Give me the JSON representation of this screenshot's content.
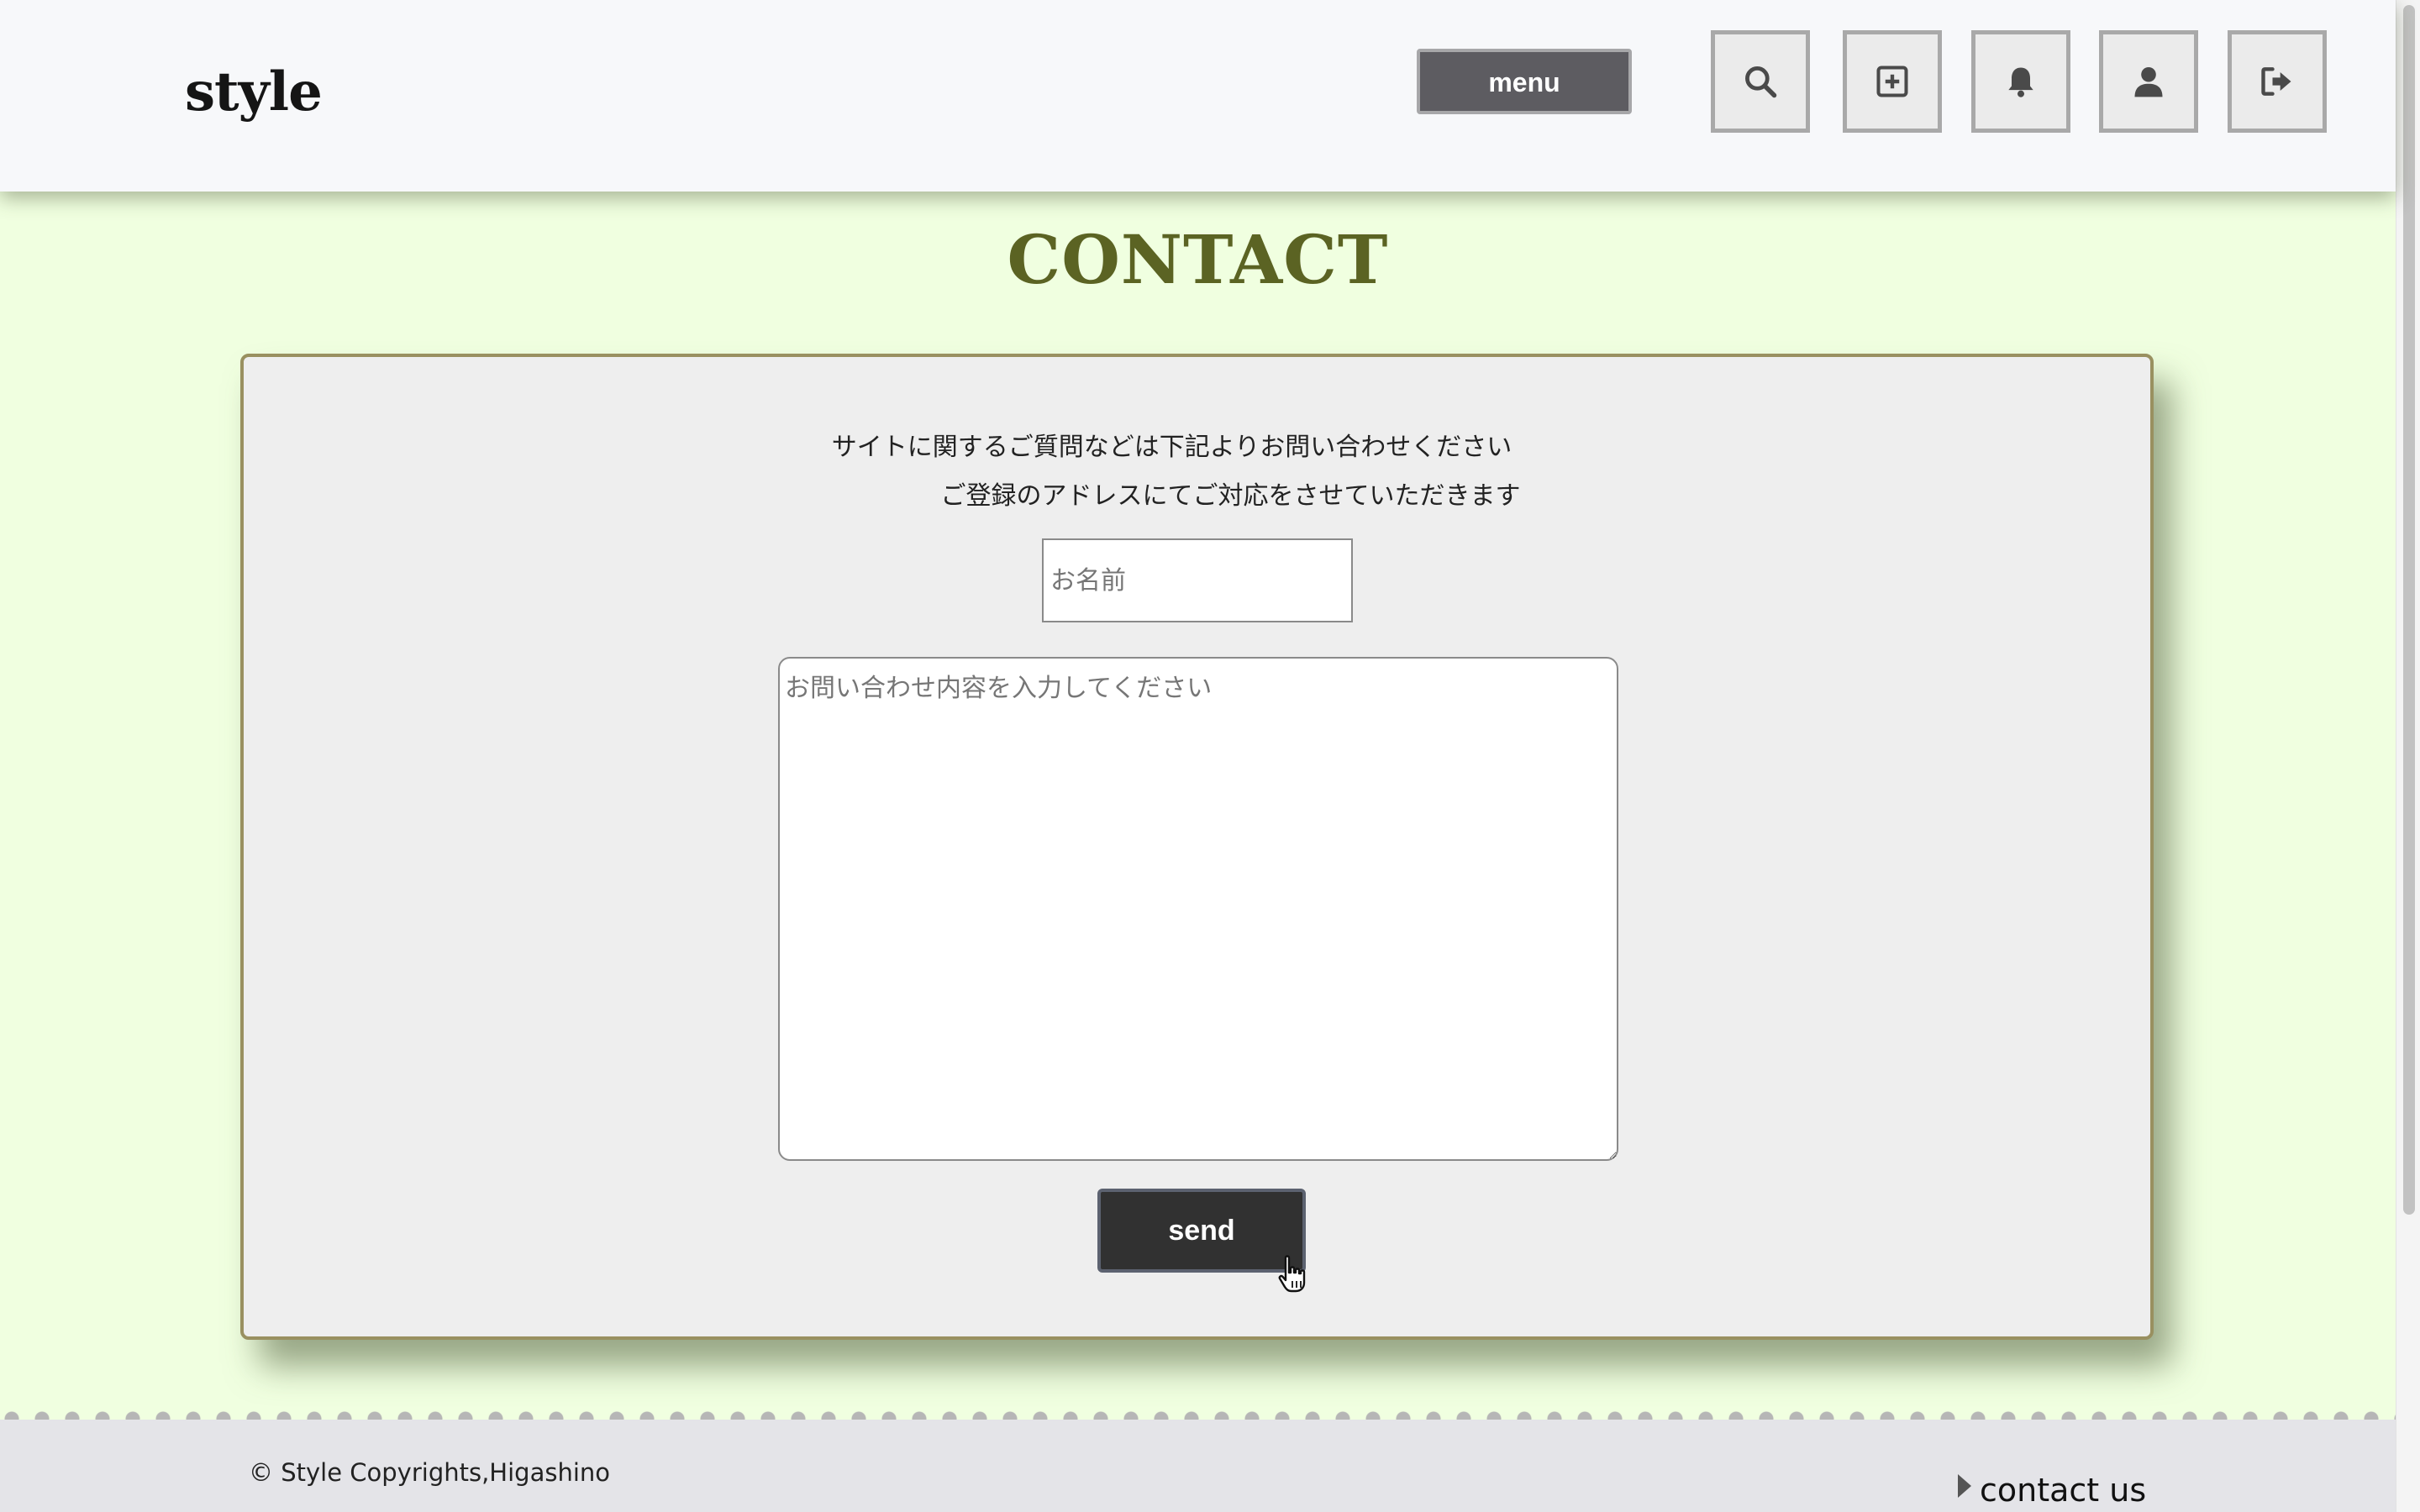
{
  "header": {
    "logo": "style",
    "menu_label": "menu",
    "icons": [
      "search-icon",
      "add-post-icon",
      "bell-icon",
      "user-icon",
      "logout-icon"
    ]
  },
  "page_title": "CONTACT",
  "form": {
    "intro_line1": "サイトに関するご質問などは下記よりお問い合わせください",
    "intro_line2": "ご登録のアドレスにてご対応をさせていただきます",
    "name_placeholder": "お名前",
    "name_value": "",
    "message_placeholder": "お問い合わせ内容を入力してください",
    "message_value": "",
    "send_label": "send"
  },
  "footer": {
    "copyright": "© Style Copyrights,Higashino",
    "contact_link": "contact us"
  },
  "colors": {
    "background": "#f0ffe0",
    "title": "#5b6323",
    "card_border": "#999060",
    "menu_button": "#5d5c61",
    "send_button": "#313131"
  }
}
